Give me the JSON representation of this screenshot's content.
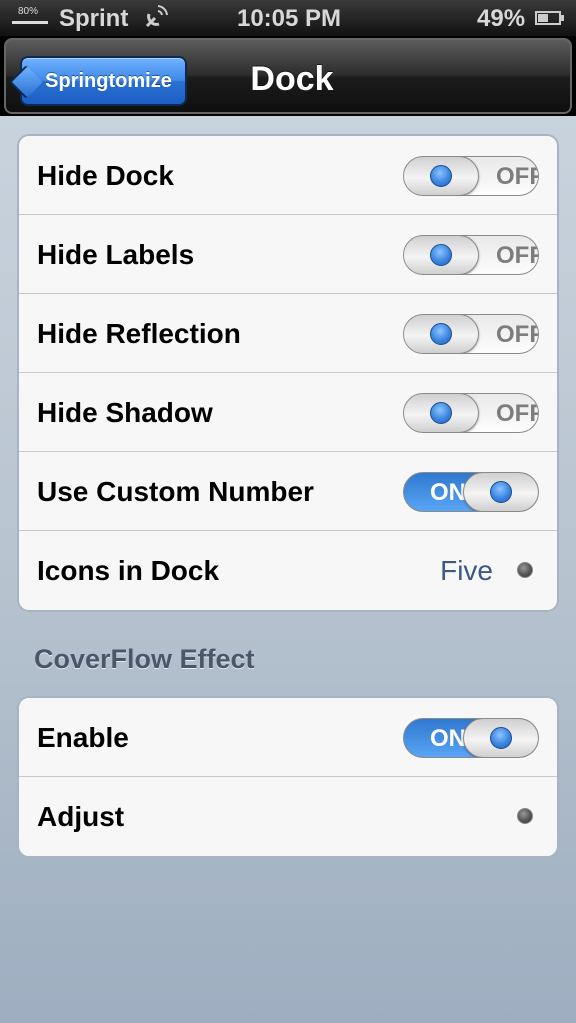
{
  "status_bar": {
    "signal_percent": "80%",
    "carrier": "Sprint",
    "time": "10:05 PM",
    "battery": "49%",
    "icons": [
      "signal-icon",
      "satellite-icon",
      "battery-icon"
    ]
  },
  "nav": {
    "back_label": "Springtomize",
    "title": "Dock"
  },
  "dock_group": {
    "rows": [
      {
        "label": "Hide Dock",
        "toggle": "OFF"
      },
      {
        "label": "Hide Labels",
        "toggle": "OFF"
      },
      {
        "label": "Hide Reflection",
        "toggle": "OFF"
      },
      {
        "label": "Hide Shadow",
        "toggle": "OFF"
      },
      {
        "label": "Use Custom Number",
        "toggle": "ON"
      },
      {
        "label": "Icons in Dock",
        "value": "Five"
      }
    ]
  },
  "coverflow_section": {
    "header": "CoverFlow Effect",
    "rows": [
      {
        "label": "Enable",
        "toggle": "ON"
      },
      {
        "label": "Adjust"
      }
    ]
  },
  "colors": {
    "accent_blue": "#3f8ae8",
    "value_text": "#3b5a85",
    "background": "#b7c3cf"
  }
}
